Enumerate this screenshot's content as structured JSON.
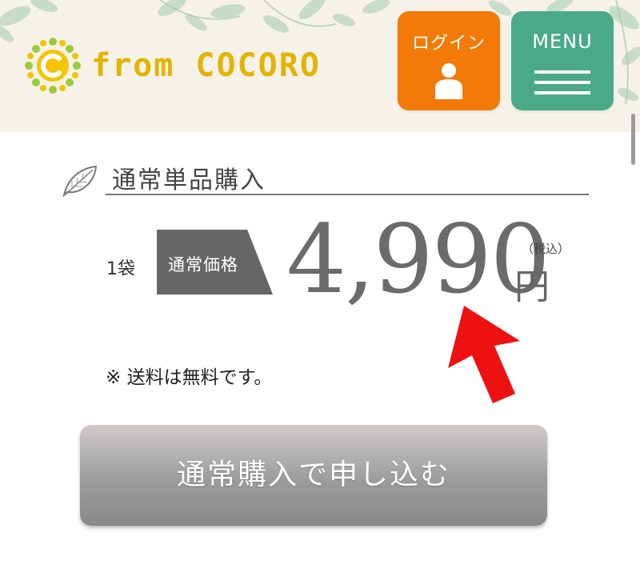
{
  "header": {
    "logo_text": "from COCORO",
    "login_label": "ログイン",
    "menu_label": "MENU"
  },
  "section": {
    "title": "通常単品購入"
  },
  "price": {
    "quantity": "1袋",
    "tag_label": "通常価格",
    "amount": "4,990",
    "currency": "円",
    "tax_note": "（税込）"
  },
  "shipping_note": "※ 送料は無料です。",
  "cta": {
    "label": "通常購入で申し込む"
  },
  "colors": {
    "login_button": "#f37a06",
    "menu_button": "#4aa988",
    "logo_yellow": "#e4b300",
    "annotation_arrow": "#ee1111"
  }
}
